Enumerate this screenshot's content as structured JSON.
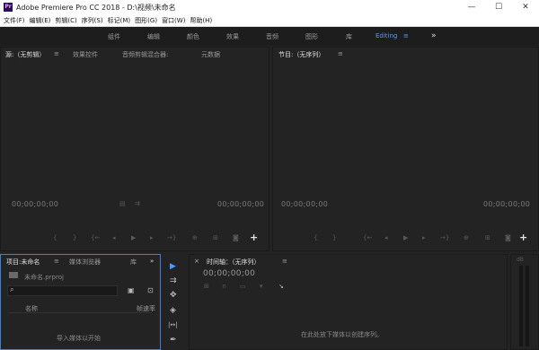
{
  "window": {
    "logo": "Pr",
    "title": "Adobe Premiere Pro CC 2018 - D:\\视频\\未命名",
    "buttons": [
      "—",
      "☐",
      "✕"
    ]
  },
  "menu": [
    "文件(F)",
    "编辑(E)",
    "剪辑(C)",
    "序列(S)",
    "标记(M)",
    "图形(G)",
    "窗口(W)",
    "帮助(H)"
  ],
  "workspaces": {
    "items": [
      "组件",
      "编辑",
      "颜色",
      "效果",
      "音频",
      "图形",
      "库"
    ],
    "active": "Editing",
    "active_menu": "≡",
    "more": "»"
  },
  "source_panel": {
    "tabs": [
      "源:（无剪辑）",
      "≡",
      "效果控件",
      "音频剪辑混合器:",
      "元数据"
    ],
    "timecode_left": "00;00;00;00",
    "timecode_right": "00;00;00;00",
    "ctl_icons": [
      "▤",
      "⇉"
    ],
    "transport": [
      "{",
      "}",
      "{←",
      "◂",
      "▶",
      "▸",
      "→}",
      "⊕",
      "⊞",
      "◙",
      "+"
    ]
  },
  "program_panel": {
    "tabs": [
      "节目:（无序列）",
      "≡"
    ],
    "timecode_left": "00;00;00;00",
    "timecode_right": "00;00;00;00",
    "transport": [
      "{",
      "}",
      "{←",
      "◂",
      "▶",
      "▸",
      "→}",
      "⊕",
      "⊞",
      "◙",
      "+"
    ]
  },
  "project_panel": {
    "tabs": [
      "项目:未命名",
      "≡",
      "媒体浏览器",
      "库",
      "»"
    ],
    "project_file": "未命名.prproj",
    "search_icon": "⌕",
    "icons": [
      "▣",
      "⊡"
    ],
    "columns": [
      "名称",
      "帧速率"
    ],
    "empty_hint": "导入媒体以开始"
  },
  "tools": [
    "▶",
    "⇉",
    "✥",
    "◈",
    "|↔|",
    "✒"
  ],
  "timeline_panel": {
    "close": "×",
    "tabs": [
      "时间轴：（无序列）",
      "≡"
    ],
    "timecode": "00;00;00;00",
    "tool_icons": [
      "⊞",
      "∩",
      "▭",
      "▾",
      "↘"
    ],
    "drop_hint": "在此处放下媒体以创建序列。"
  },
  "audio_meter": {
    "label": "dB"
  }
}
